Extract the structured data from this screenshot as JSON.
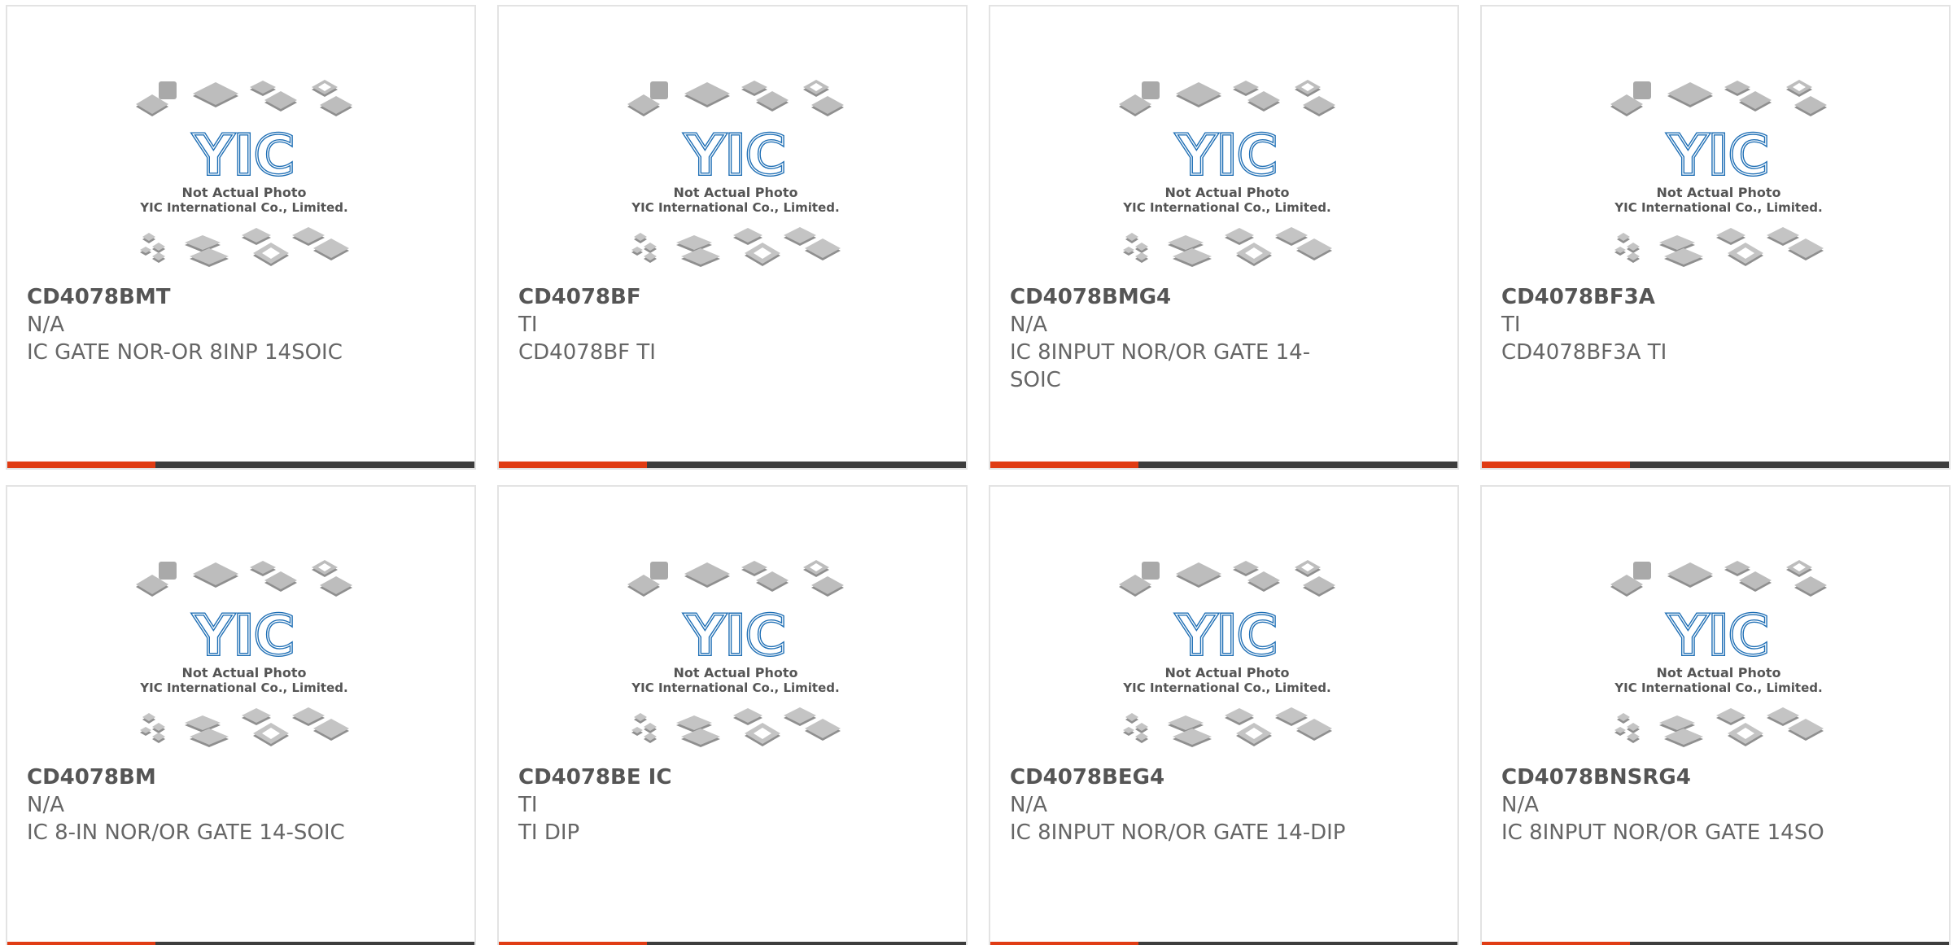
{
  "colors": {
    "accent": "#e03c14",
    "bar": "#3d3d3d",
    "logo": "#1f6fb5",
    "caption": "#555555"
  },
  "photo": {
    "caption_line1": "Not Actual Photo",
    "caption_line2": "YIC International Co., Limited.",
    "logo_text": "YIC"
  },
  "products": [
    {
      "part": "CD4078BMT",
      "manufacturer": "N/A",
      "description": "IC GATE NOR-OR 8INP 14SOIC"
    },
    {
      "part": "CD4078BF",
      "manufacturer": "TI",
      "description": "CD4078BF TI"
    },
    {
      "part": "CD4078BMG4",
      "manufacturer": "N/A",
      "description": "IC 8INPUT NOR/OR GATE 14-SOIC"
    },
    {
      "part": "CD4078BF3A",
      "manufacturer": "TI",
      "description": "CD4078BF3A TI"
    },
    {
      "part": "CD4078BM",
      "manufacturer": "N/A",
      "description": "IC 8-IN NOR/OR GATE 14-SOIC"
    },
    {
      "part": "CD4078BE IC",
      "manufacturer": "TI",
      "description": "TI DIP"
    },
    {
      "part": "CD4078BEG4",
      "manufacturer": "N/A",
      "description": "IC 8INPUT NOR/OR GATE 14-DIP"
    },
    {
      "part": "CD4078BNSRG4",
      "manufacturer": "N/A",
      "description": "IC 8INPUT NOR/OR GATE 14SO"
    }
  ]
}
